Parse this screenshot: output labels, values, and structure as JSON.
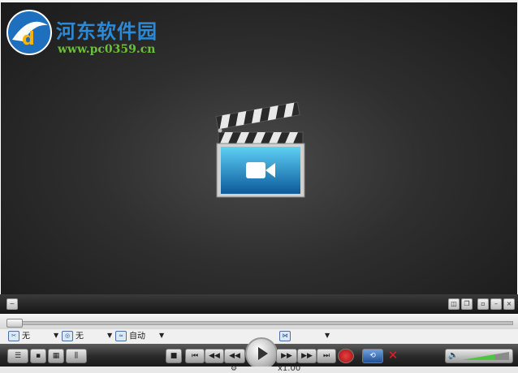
{
  "watermark": {
    "title": "河东软件园",
    "url": "www.pc0359.cn"
  },
  "toolbar": {
    "left_icon": "waveform-icon",
    "right_icons": [
      "snapshot-icon",
      "restore-icon",
      "minimode-icon",
      "minimize-icon",
      "close-icon"
    ]
  },
  "options": {
    "subtitle_icon": "scissors-icon",
    "subtitle_value": "无",
    "audio_icon": "target-icon",
    "audio_value": "无",
    "ratio_icon": "wave-icon",
    "ratio_value": "自动",
    "eq_icon": "bowtie-icon"
  },
  "controls": {
    "view_modes": [
      "playlist-icon",
      "single-icon",
      "grid-icon",
      "eq-icon"
    ],
    "transport": [
      "stop-icon",
      "previous-icon",
      "step-back-icon",
      "rewind-icon",
      "play-icon",
      "forward-icon",
      "step-forward-icon",
      "next-icon",
      "record-icon"
    ],
    "extra": [
      "loop-icon",
      "remove-icon"
    ],
    "volume_level": 0.7
  },
  "status": {
    "speed": "x1.00"
  },
  "colors": {
    "watermark_title": "#2a8ad8",
    "watermark_url": "#6abf3a",
    "record": "#c81e1e",
    "volume": "#4ec53e"
  }
}
